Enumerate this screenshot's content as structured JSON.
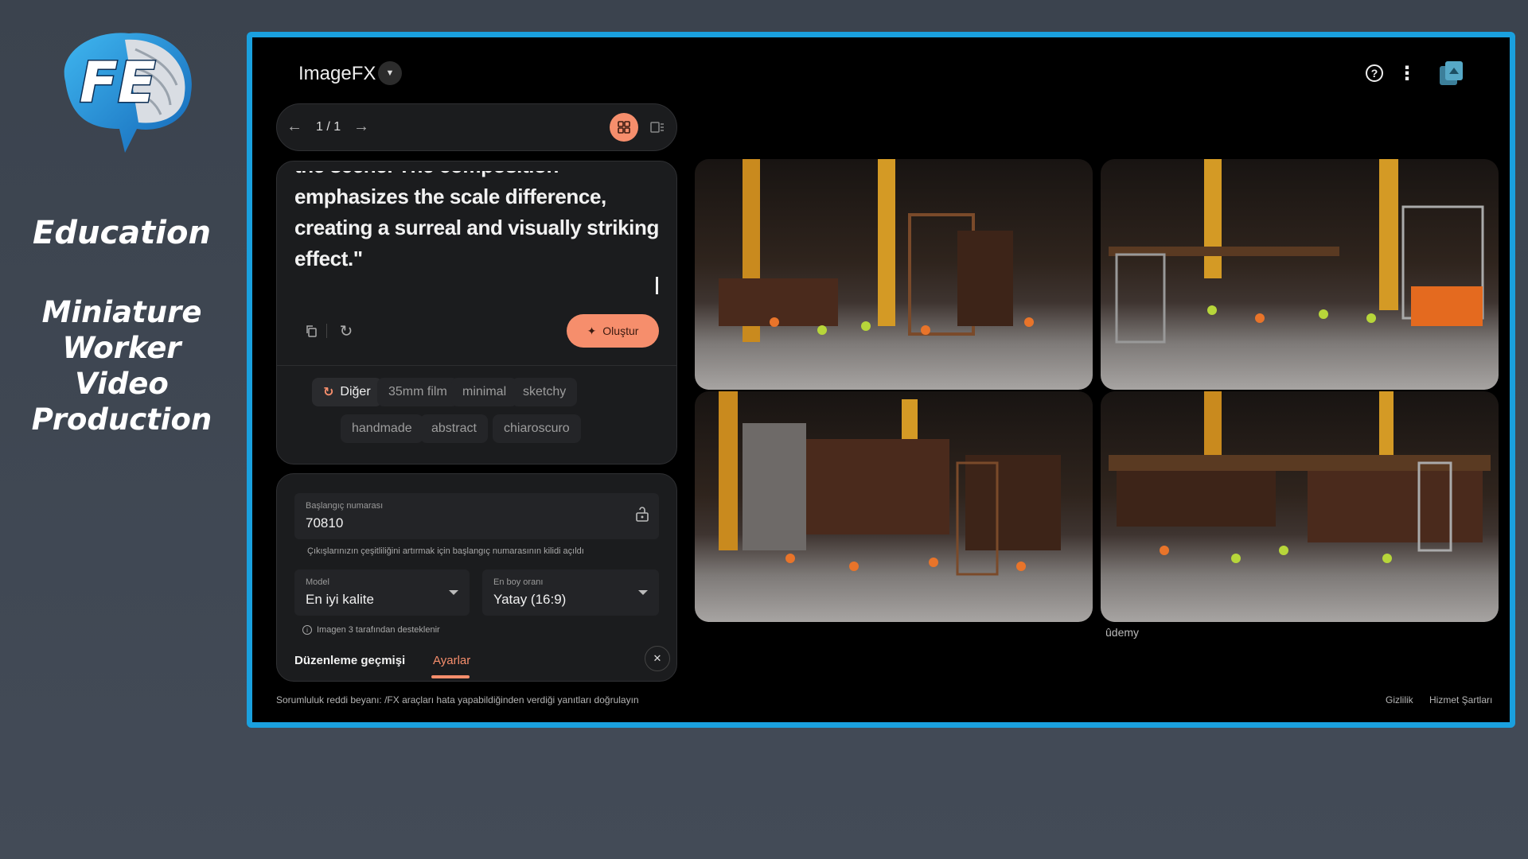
{
  "sidebar": {
    "logo_text": "FE",
    "title": "Education",
    "subtitle_lines": [
      "Miniature",
      "Worker",
      "Video",
      "Production"
    ]
  },
  "app": {
    "title": "ImageFX",
    "icons": {
      "dropdown": "chevron-down-icon",
      "help": "help-icon",
      "more": "more-vertical-icon",
      "app": "library-icon"
    }
  },
  "navigation": {
    "counter": "1 / 1"
  },
  "prompt": {
    "lines": [
      "the scene. The composition",
      "emphasizes the scale difference,",
      "creating a surreal and visually striking",
      "effect.\""
    ],
    "create_label": "Oluştur"
  },
  "chips": [
    {
      "label": "Diğer",
      "active": true
    },
    {
      "label": "35mm film"
    },
    {
      "label": "minimal"
    },
    {
      "label": "sketchy"
    },
    {
      "label": "handmade"
    },
    {
      "label": "abstract"
    },
    {
      "label": "chiaroscuro"
    }
  ],
  "settings": {
    "seed_label": "Başlangıç numarası",
    "seed_value": "70810",
    "seed_note": "Çıkışlarınızın çeşitliliğini artırmak için başlangıç numarasının kilidi açıldı",
    "model_label": "Model",
    "model_value": "En iyi kalite",
    "ratio_label": "En boy oranı",
    "ratio_value": "Yatay (16:9)",
    "imagen_note": "Imagen 3 tarafından desteklenir",
    "tab_history": "Düzenleme geçmişi",
    "tab_settings": "Ayarlar"
  },
  "gallery": {
    "watermark": "ûdemy"
  },
  "footer": {
    "disclaimer": "Sorumluluk reddi beyanı: /FX araçları hata yapabildiğinden verdiği yanıtları doğrulayın",
    "privacy": "Gizlilik",
    "terms": "Hizmet Şartları"
  },
  "colors": {
    "accent": "#f68e6c",
    "frame_border": "#1aa0de",
    "background": "#3b434e"
  }
}
